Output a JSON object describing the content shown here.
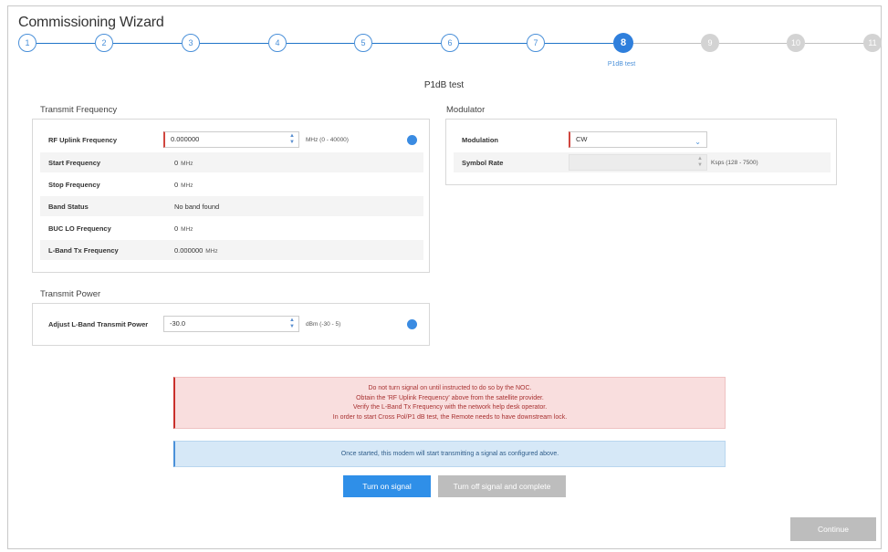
{
  "window": {
    "title": "Commissioning Wizard"
  },
  "stepper": {
    "steps": [
      {
        "label": "1",
        "state": "done"
      },
      {
        "label": "2",
        "state": "done"
      },
      {
        "label": "3",
        "state": "done"
      },
      {
        "label": "4",
        "state": "done"
      },
      {
        "label": "5",
        "state": "done"
      },
      {
        "label": "6",
        "state": "done"
      },
      {
        "label": "7",
        "state": "done"
      },
      {
        "label": "8",
        "state": "active"
      },
      {
        "label": "9",
        "state": "todo"
      },
      {
        "label": "10",
        "state": "todo"
      },
      {
        "label": "11",
        "state": "todo"
      }
    ],
    "active_caption": "P1dB test"
  },
  "page": {
    "heading": "P1dB test"
  },
  "transmit_frequency": {
    "section_label": "Transmit Frequency",
    "rf_uplink": {
      "label": "RF Uplink Frequency",
      "value": "0.000000",
      "range": "MHz (0 - 40000)"
    },
    "rows": [
      {
        "label": "Start Frequency",
        "value": "0",
        "unit": "MHz"
      },
      {
        "label": "Stop Frequency",
        "value": "0",
        "unit": "MHz"
      },
      {
        "label": "Band Status",
        "value": "No band found",
        "unit": ""
      },
      {
        "label": "BUC LO Frequency",
        "value": "0",
        "unit": "MHz"
      },
      {
        "label": "L-Band Tx Frequency",
        "value": "0.000000",
        "unit": "MHz"
      }
    ]
  },
  "modulator": {
    "section_label": "Modulator",
    "modulation": {
      "label": "Modulation",
      "value": "CW"
    },
    "symbol_rate": {
      "label": "Symbol Rate",
      "value": "",
      "range": "Ksps (128 - 7500)"
    }
  },
  "transmit_power": {
    "section_label": "Transmit Power",
    "adjust": {
      "label": "Adjust L-Band Transmit Power",
      "value": "-30.0",
      "range": "dBm (-30 - 5)"
    }
  },
  "alerts": {
    "warning_lines": [
      "Do not turn signal on until instructed to do so by the NOC.",
      "Obtain the 'RF Uplink Frequency' above from the satellite provider.",
      "Verify the L-Band Tx Frequency with the network help desk operator.",
      "In order to start Cross Pol/P1 dB test, the Remote needs to have downstream lock."
    ],
    "info": "Once started, this modem will start transmitting a signal as configured above."
  },
  "buttons": {
    "turn_on": "Turn on signal",
    "turn_off": "Turn off signal and complete",
    "continue": "Continue"
  },
  "colors": {
    "accent": "#2f8fe8",
    "required": "#d0463f",
    "warning_bg": "#f9dede",
    "info_bg": "#d6e8f7",
    "disabled": "#bdbdbd"
  }
}
